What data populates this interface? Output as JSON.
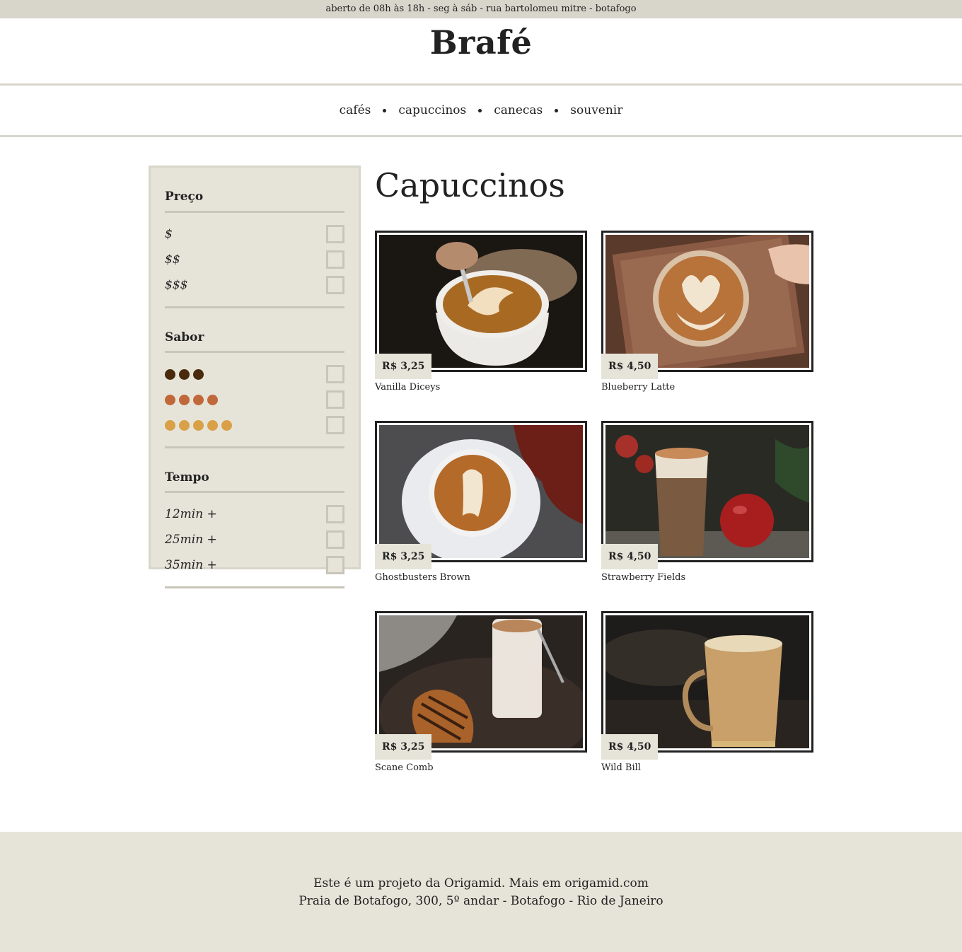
{
  "topbar": {
    "text": "aberto de 08h às 18h - seg à sáb - rua bartolomeu mitre - botafogo"
  },
  "brand": {
    "name": "Brafé"
  },
  "nav": {
    "items": [
      "cafés",
      "capuccinos",
      "canecas",
      "souvenir"
    ]
  },
  "filters": {
    "price": {
      "title": "Preço",
      "options": [
        "$",
        "$$",
        "$$$"
      ]
    },
    "flavor": {
      "title": "Sabor",
      "levels": [
        {
          "count": 3,
          "color": "#4a2a0c"
        },
        {
          "count": 4,
          "color": "#c0683a"
        },
        {
          "count": 5,
          "color": "#d9a048"
        }
      ]
    },
    "time": {
      "title": "Tempo",
      "options": [
        "12min +",
        "25min +",
        "35min +"
      ]
    }
  },
  "main": {
    "heading": "Capuccinos"
  },
  "products": [
    {
      "name": "Vanilla Diceys",
      "price": "R$ 3,25",
      "image": "latte-art-pour-photo"
    },
    {
      "name": "Blueberry Latte",
      "price": "R$ 4,50",
      "image": "heart-latte-on-tray-photo"
    },
    {
      "name": "Ghostbusters Brown",
      "price": "R$ 3,25",
      "image": "ghost-latte-art-photo"
    },
    {
      "name": "Strawberry Fields",
      "price": "R$ 4,50",
      "image": "glass-mocha-with-apples-photo"
    },
    {
      "name": "Scane Comb",
      "price": "R$ 3,25",
      "image": "croissant-and-latte-photo"
    },
    {
      "name": "Wild Bill",
      "price": "R$ 4,50",
      "image": "glass-mug-coffee-photo"
    }
  ],
  "footer": {
    "line1": "Este é um projeto da Origamid. Mais em origamid.com",
    "line2": "Praia de Botafogo, 300, 5º andar - Botafogo - Rio de Janeiro"
  }
}
